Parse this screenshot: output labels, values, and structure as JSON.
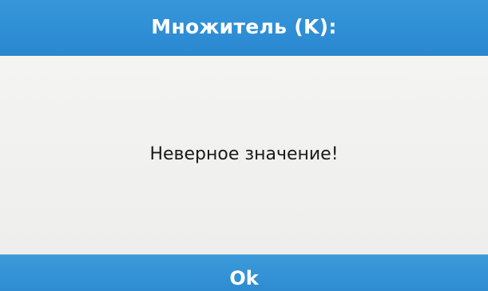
{
  "dialog": {
    "title": "Множитель (K):",
    "message": "Неверное значение!",
    "ok_label": "Ok"
  },
  "colors": {
    "header_bg": "#2f8fd6",
    "footer_bg": "#3392d5",
    "body_bg": "#f1f1ef",
    "title_text": "#ffffff",
    "message_text": "#1a1a1a"
  }
}
